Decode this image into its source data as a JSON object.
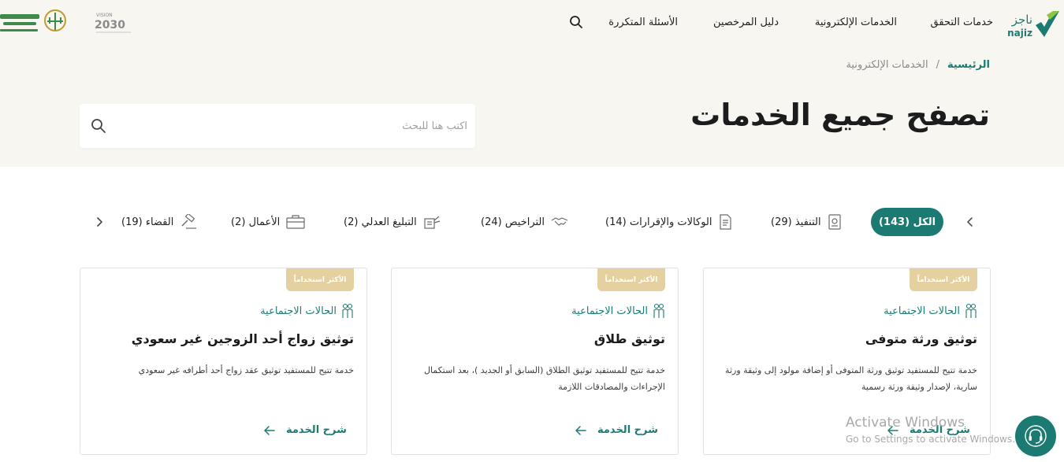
{
  "header": {
    "nav": [
      "خدمات التحقق",
      "الخدمات الإلكترونية",
      "دليل المرخصين",
      "الأسئلة المتكررة"
    ],
    "brand": {
      "najiz_ar": "ناجز",
      "najiz_en": "najiz",
      "vision_label": "VISION",
      "vision_year": "2030"
    }
  },
  "breadcrumb": {
    "home": "الرئيسية",
    "separator": "/",
    "current": "الخدمات الإلكترونية"
  },
  "page": {
    "title": "تصفح جميع الخدمات",
    "search_placeholder": "اكتب هنا للبحث"
  },
  "tabs": [
    {
      "label": "الكل (143)",
      "icon": "none",
      "active": true
    },
    {
      "label": "التنفيذ (29)",
      "icon": "execution-icon",
      "active": false
    },
    {
      "label": "الوكالات والإقرارات (14)",
      "icon": "document-icon",
      "active": false
    },
    {
      "label": "التراخيص (24)",
      "icon": "handshake-icon",
      "active": false
    },
    {
      "label": "التبليغ العدلي (2)",
      "icon": "notification-icon",
      "active": false
    },
    {
      "label": "الأعمال (2)",
      "icon": "briefcase-icon",
      "active": false
    },
    {
      "label": "القضاء (19)",
      "icon": "gavel-icon",
      "active": false
    }
  ],
  "cards": [
    {
      "badge": "الأكثر استخداماً",
      "category": "الحالات الاجتماعية",
      "title": "توثيق ورثة متوفى",
      "description": "خدمة تتيح للمستفيد توثيق ورثة المتوفى أو إضافة مولود إلى وثيقة ورثة سارية، لإصدار وثيقة ورثة رسمية",
      "link": "شرح الخدمة"
    },
    {
      "badge": "الأكثر استخداماً",
      "category": "الحالات الاجتماعية",
      "title": "توثيق طلاق",
      "description": "خدمة تتيح للمستفيد توثيق الطلاق (السابق أو الجديد )، بعد استكمال الإجراءات والمصادقات اللازمة",
      "link": "شرح الخدمة"
    },
    {
      "badge": "الأكثر استخداماً",
      "category": "الحالات الاجتماعية",
      "title": "توثيق زواج أحد الزوجين غير سعودي",
      "description": "خدمة تتيح للمستفيد توثيق عقد زواج أحد أطرافه غير سعودي",
      "link": "شرح الخدمة"
    }
  ],
  "watermark": {
    "title": "Activate Windows",
    "subtitle": "Go to Settings to activate Windows."
  },
  "colors": {
    "primary": "#1b7b72",
    "badge": "#e4d19f",
    "hero_bg": "#f8f6f1"
  }
}
